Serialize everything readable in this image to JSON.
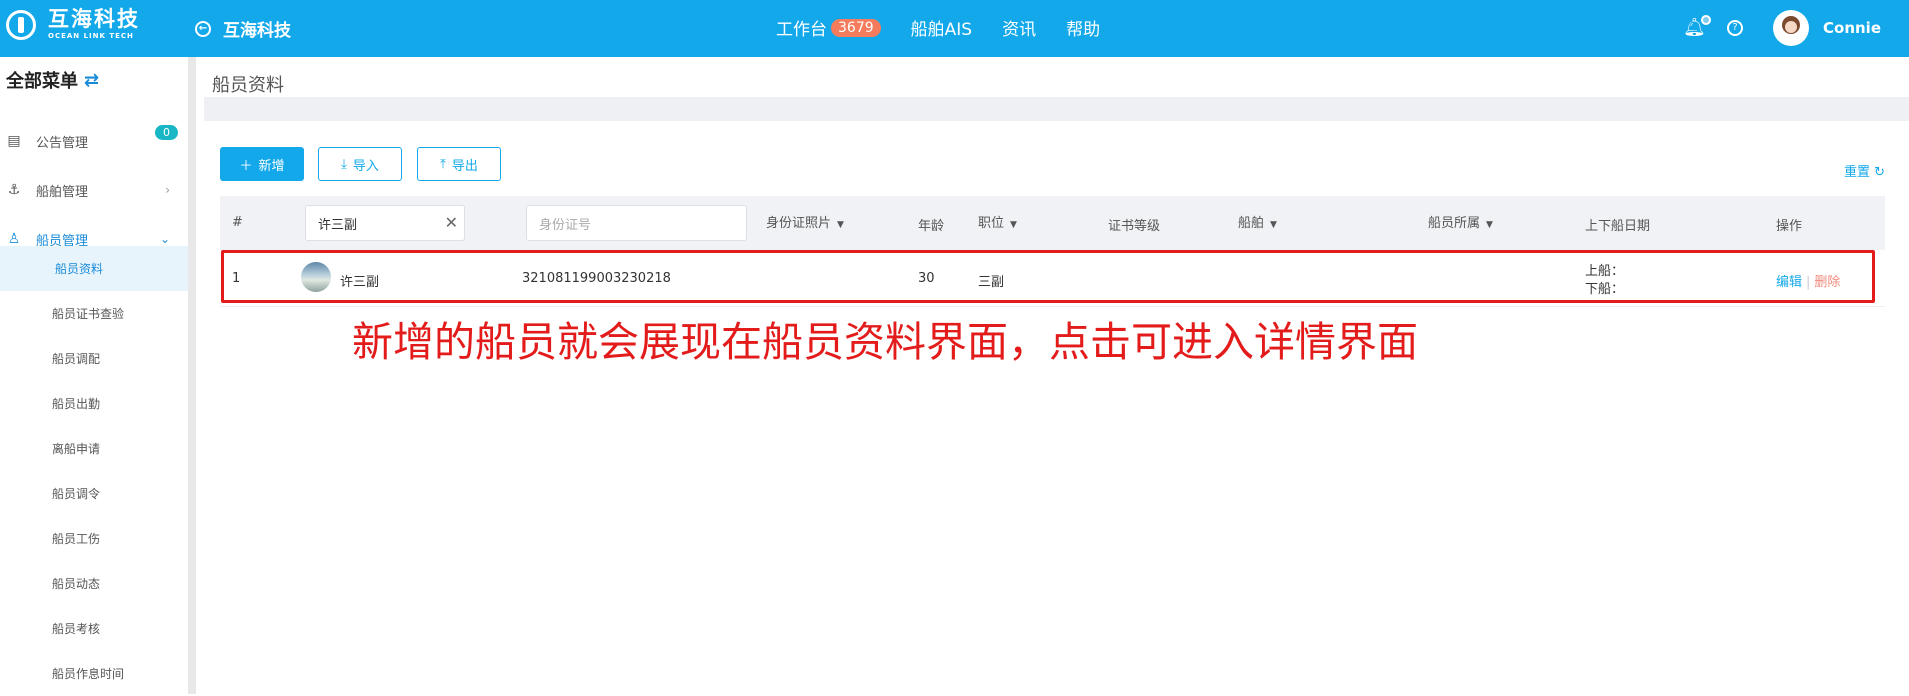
{
  "header": {
    "logo_cn": "互海科技",
    "logo_en": "OCEAN LINK TECH",
    "back_title": "互海科技",
    "nav": [
      {
        "label": "工作台",
        "badge": "3679"
      },
      {
        "label": "船舶AIS"
      },
      {
        "label": "资讯"
      },
      {
        "label": "帮助"
      }
    ],
    "username": "Connie"
  },
  "sidebar": {
    "title": "全部菜单",
    "items": [
      {
        "label": "公告管理",
        "count": "0"
      },
      {
        "label": "船舶管理"
      },
      {
        "label": "船员管理"
      }
    ],
    "subitems": [
      "船员资料",
      "船员证书查验",
      "船员调配",
      "船员出勤",
      "离船申请",
      "船员调令",
      "船员工伤",
      "船员动态",
      "船员考核",
      "船员作息时间"
    ]
  },
  "page": {
    "breadcrumb": "船员资料",
    "buttons": {
      "add": "新增",
      "import": "导入",
      "export": "导出"
    },
    "reset": "重置"
  },
  "table": {
    "headers": {
      "index": "#",
      "id_photo": "身份证照片",
      "age": "年龄",
      "position": "职位",
      "cert_level": "证书等级",
      "ship": "船舶",
      "belongs": "船员所属",
      "dates": "上下船日期",
      "ops": "操作"
    },
    "filters": {
      "name_value": "许三副",
      "id_placeholder": "身份证号"
    },
    "rows": [
      {
        "index": "1",
        "name": "许三副",
        "id_number": "321081199003230218",
        "age": "30",
        "position": "三副",
        "board_on": "上船：",
        "board_off": "下船：",
        "edit": "编辑",
        "delete": "删除"
      }
    ]
  },
  "annotation": "新增的船员就会展现在船员资料界面，点击可进入详情界面",
  "colors": {
    "primary": "#13a8ea",
    "badge": "#f47c5c",
    "annotation": "#e31b1b"
  }
}
